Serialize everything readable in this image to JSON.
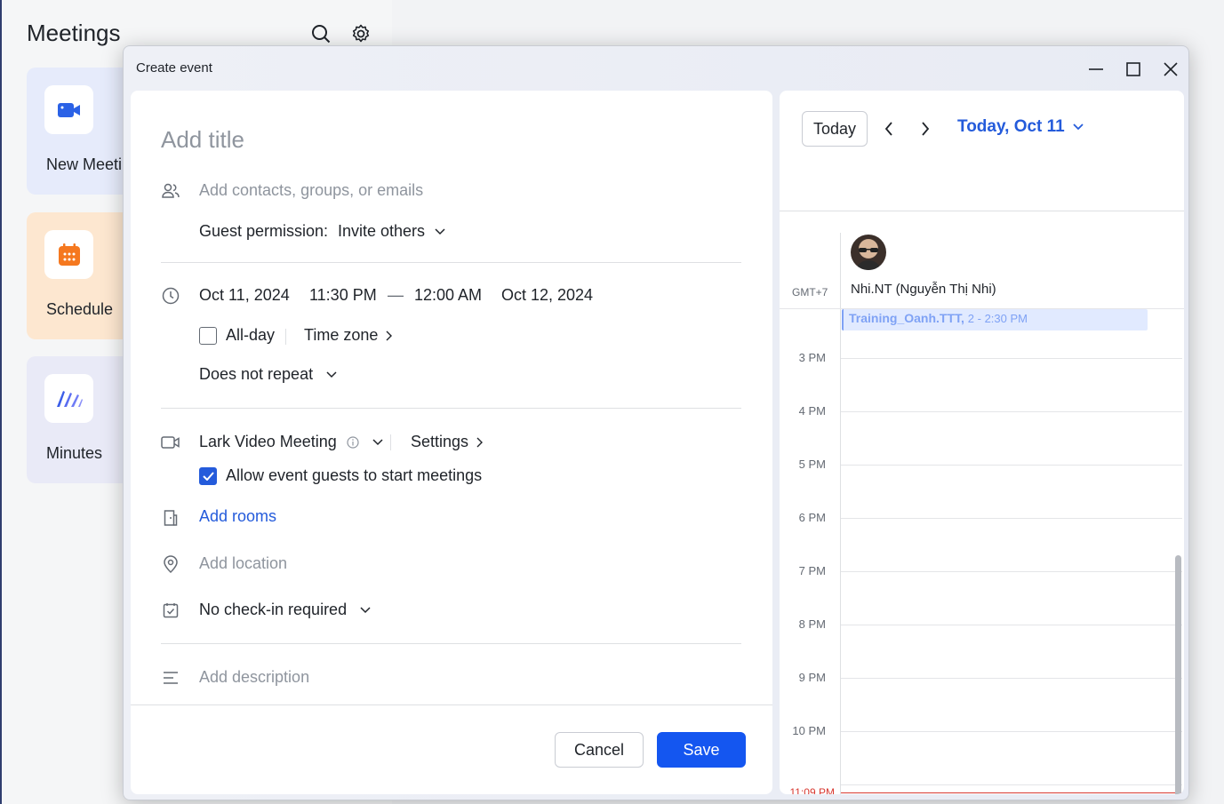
{
  "background_app": {
    "title": "Meetings",
    "cards": [
      {
        "label": "New Meetin",
        "color": "#e6ebfb",
        "icon": "video-camera-icon"
      },
      {
        "label": "Schedule",
        "color": "#fde7d0",
        "icon": "calendar-icon"
      },
      {
        "label": "Minutes",
        "color": "#e9eaf7",
        "icon": "minutes-icon"
      }
    ]
  },
  "dialog": {
    "title": "Create event",
    "form": {
      "title_placeholder": "Add title",
      "guests_placeholder": "Add contacts, groups, or emails",
      "guest_permission_label": "Guest permission:",
      "guest_permission_value": "Invite others",
      "start_date": "Oct 11, 2024",
      "start_time": "11:30 PM",
      "dash": "—",
      "end_time": "12:00 AM",
      "end_date": "Oct 12, 2024",
      "allday_label": "All-day",
      "timezone_label": "Time zone",
      "repeat_value": "Does not repeat",
      "video_meeting_value": "Lark Video Meeting",
      "settings_label": "Settings",
      "allow_guests_label": "Allow event guests to start meetings",
      "add_rooms_label": "Add rooms",
      "location_placeholder": "Add location",
      "checkin_value": "No check-in required",
      "description_placeholder": "Add description"
    },
    "buttons": {
      "cancel": "Cancel",
      "save": "Save"
    },
    "calendar": {
      "today_button": "Today",
      "date_title": "Today, Oct 11",
      "timezone": "GMT+7",
      "person_name": "Nhi.NT (Nguyễn Thị Nhi)",
      "event_title": "Training_Oanh.TTT,",
      "event_time": "2 - 2:30 PM",
      "hours": [
        "3 PM",
        "4 PM",
        "5 PM",
        "6 PM",
        "7 PM",
        "8 PM",
        "9 PM",
        "10 PM"
      ],
      "now_label": "11:09 PM"
    }
  },
  "colors": {
    "accent": "#245bdb",
    "save_button": "#1456f0",
    "now_line": "#d83931"
  }
}
